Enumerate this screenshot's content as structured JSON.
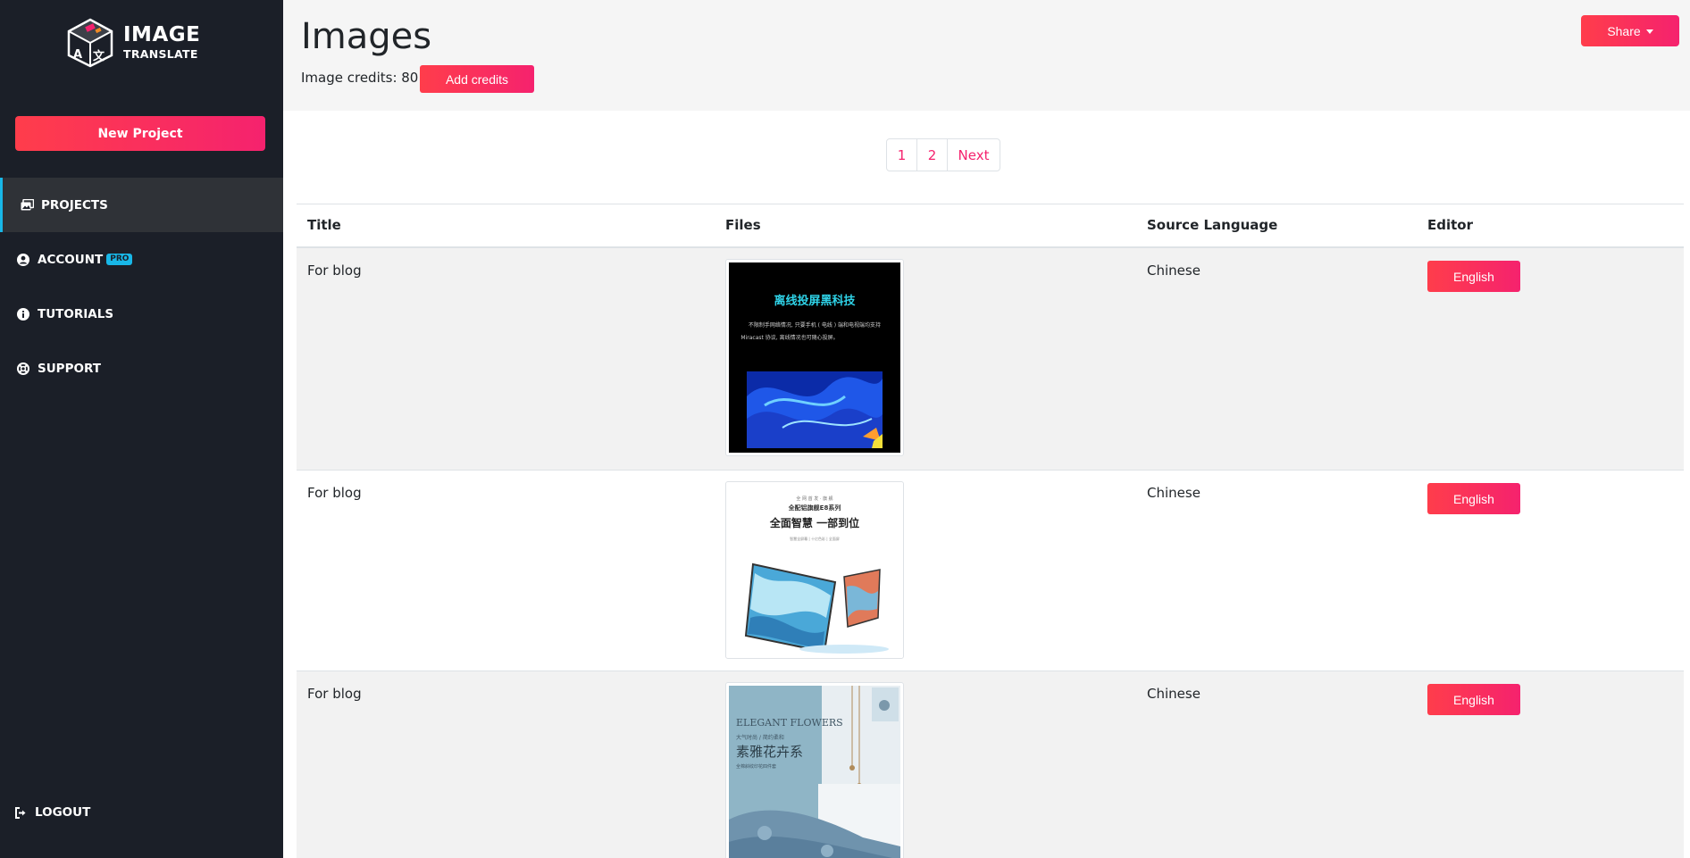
{
  "app": {
    "logo_line1": "IMAGE",
    "logo_line2": "TRANSLATE"
  },
  "sidebar": {
    "new_project_label": "New Project",
    "items": [
      {
        "label": "PROJECTS",
        "icon": "images-icon",
        "active": true
      },
      {
        "label": "ACCOUNT",
        "icon": "user-circle-icon",
        "badge": "PRO"
      },
      {
        "label": "TUTORIALS",
        "icon": "info-circle-icon"
      },
      {
        "label": "SUPPORT",
        "icon": "life-ring-icon"
      }
    ],
    "logout_label": "LOGOUT"
  },
  "header": {
    "title": "Images",
    "credits_text": "Image credits: 80",
    "add_credits_label": "Add credits",
    "share_label": "Share"
  },
  "pagination": {
    "pages": [
      "1",
      "2"
    ],
    "next_label": "Next"
  },
  "table": {
    "headers": [
      "Title",
      "Files",
      "Source Language",
      "Editor"
    ],
    "rows": [
      {
        "title": "For blog",
        "source_language": "Chinese",
        "editor": "English",
        "image_headline": "离线投屏黑科技",
        "image_subline1": "不限制手网络情况, 只要手机 ( 电线 ) 端和电视端均支持",
        "image_subline2": "Miracast 协议, 离线情况也可随心投屏。"
      },
      {
        "title": "For blog",
        "source_language": "Chinese",
        "editor": "English",
        "image_top": "全 网 首 发 · 旗 舰",
        "image_series": "全配铝旗舰E8系列",
        "image_headline": "全面智慧 一部到位",
        "image_small": "智慧全屏幕 | 十亿色彩 | 全面屏"
      },
      {
        "title": "For blog",
        "source_language": "Chinese",
        "editor": "English",
        "image_en": "ELEGANT FLOWERS",
        "image_small": "大气时尚 / 简约柔和",
        "image_headline": "素雅花卉系",
        "image_small2": "全棉斜纹印花四件套"
      }
    ]
  },
  "colors": {
    "sidebar_bg": "#1b1f28",
    "accent_start": "#ff3d4b",
    "accent_end": "#f5226e",
    "active_indicator": "#18b7e8"
  }
}
